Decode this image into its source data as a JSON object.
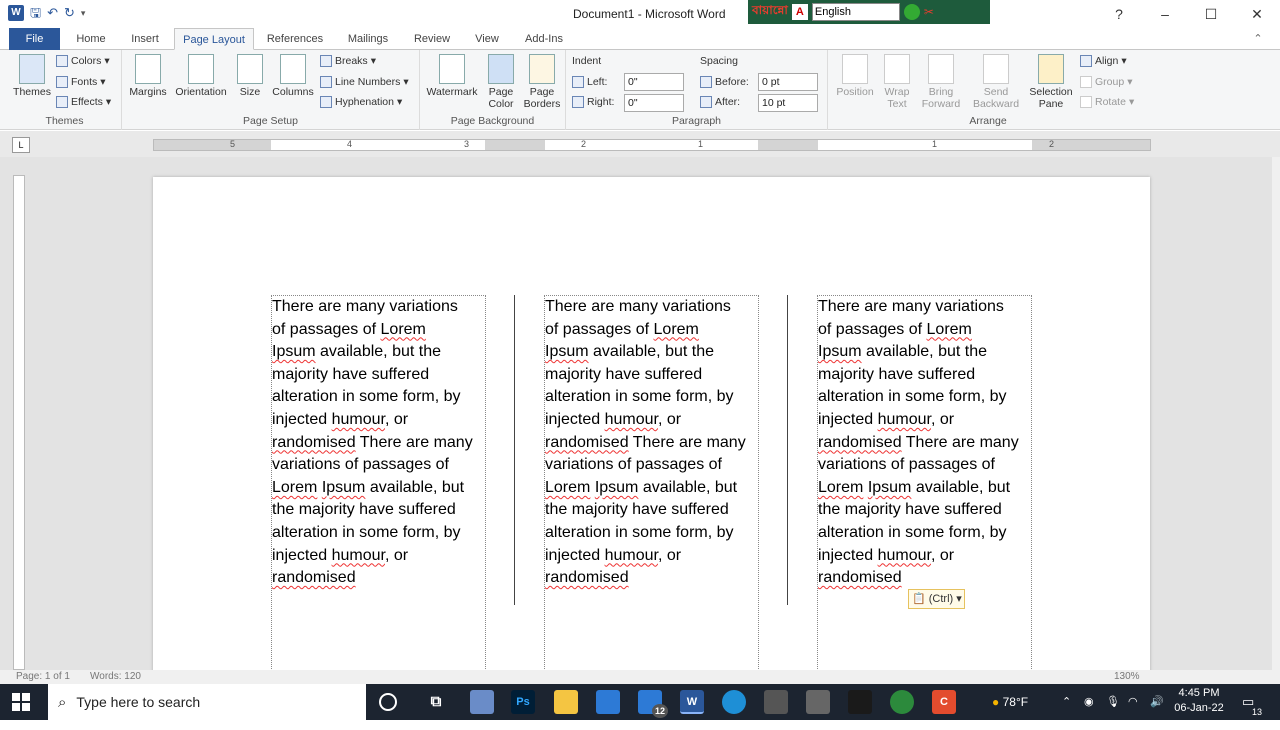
{
  "title": "Document1 - Microsoft Word",
  "quick_access": {
    "app_icon": "word-icon",
    "save": "save-icon",
    "undo": "undo-icon",
    "redo": "redo-icon",
    "customize": "customize-qat-icon"
  },
  "bangla_toolbar": {
    "logo": "বায়ান্নো",
    "letter": "A",
    "language": "English"
  },
  "window_controls": {
    "minimize": "–",
    "maximize": "☐",
    "close": "✕"
  },
  "tabs": [
    "File",
    "Home",
    "Insert",
    "Page Layout",
    "References",
    "Mailings",
    "Review",
    "View",
    "Add-Ins"
  ],
  "active_tab": "Page Layout",
  "ribbon": {
    "themes": {
      "themes": "Themes",
      "colors": "Colors",
      "fonts": "Fonts",
      "effects": "Effects",
      "label": "Themes"
    },
    "page_setup": {
      "margins": "Margins",
      "orientation": "Orientation",
      "size": "Size",
      "columns": "Columns",
      "breaks": "Breaks",
      "line_numbers": "Line Numbers",
      "hyphenation": "Hyphenation",
      "label": "Page Setup"
    },
    "page_background": {
      "watermark": "Watermark",
      "page_color_1": "Page",
      "page_color_2": "Color",
      "page_borders_1": "Page",
      "page_borders_2": "Borders",
      "label": "Page Background"
    },
    "paragraph": {
      "indent": "Indent",
      "left": "Left:",
      "left_value": "0\"",
      "right": "Right:",
      "right_value": "0\"",
      "spacing": "Spacing",
      "before": "Before:",
      "before_value": "0 pt",
      "after": "After:",
      "after_value": "10 pt",
      "label": "Paragraph"
    },
    "arrange": {
      "position": "Position",
      "wrap_1": "Wrap",
      "wrap_2": "Text",
      "bring_1": "Bring",
      "bring_2": "Forward",
      "send_1": "Send",
      "send_2": "Backward",
      "selection_1": "Selection",
      "selection_2": "Pane",
      "align": "Align",
      "group": "Group",
      "rotate": "Rotate",
      "label": "Arrange"
    }
  },
  "ruler_numbers": [
    "5",
    "4",
    "3",
    "2",
    "1",
    "1",
    "2"
  ],
  "document": {
    "columns": [
      {
        "lines": [
          "There are many variations",
          "of passages of |Lorem|",
          "|Ipsum| available, but the",
          "majority have suffered",
          "alteration in some form, by",
          "injected |humour|, or",
          "|randomised| There are many",
          "variations of passages of",
          "|Lorem| |Ipsum| available, but",
          "the majority have suffered",
          "alteration in some form, by",
          "injected |humour|, or",
          "|randomised|"
        ]
      },
      {
        "lines": [
          "There are many variations",
          "of passages of |Lorem|",
          "|Ipsum| available, but the",
          "majority have suffered",
          "alteration in some form, by",
          "injected |humour|, or",
          "|randomised| There are many",
          "variations of passages of",
          "|Lorem| |Ipsum| available, but",
          "the majority have suffered",
          "alteration in some form, by",
          "injected |humour|, or",
          "|randomised|"
        ]
      },
      {
        "lines": [
          "There are many variations",
          "of passages of |Lorem|",
          "|Ipsum| available, but the",
          "majority have suffered",
          "alteration in some form, by",
          "injected |humour|, or",
          "|randomised| There are many",
          "variations of passages of",
          "|Lorem| |Ipsum| available, but",
          "the majority have suffered",
          "alteration in some form, by",
          "injected |humour|, or",
          "|randomised|"
        ]
      }
    ],
    "paste_options": "(Ctrl)"
  },
  "status": {
    "page": "Page: 1 of 1",
    "words": "Words: 120",
    "zoom": "130%"
  },
  "taskbar": {
    "search_placeholder": "Type here to search",
    "weather": "78°F",
    "time": "4:45 PM",
    "date": "06-Jan-22",
    "notifications": "13",
    "mail_badge": "12"
  }
}
